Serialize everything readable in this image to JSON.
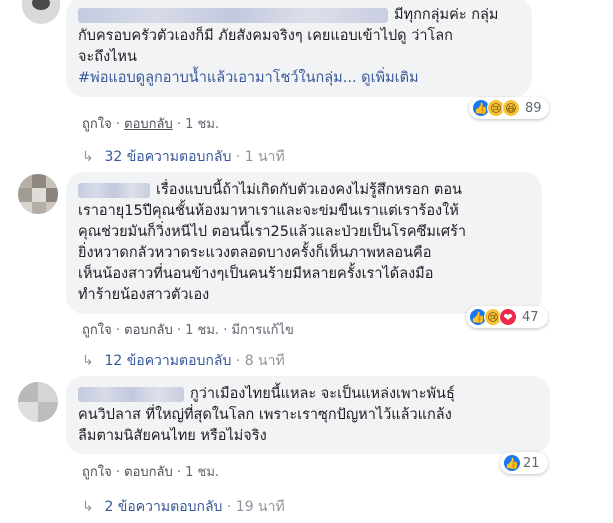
{
  "comments": [
    {
      "lines": [
        "มีทุกกลุ่มค่ะ กลุ่ม",
        "กับครอบครัวตัวเองก็มี ภัยสังคมจริงๆ เคยแอบเข้าไปดู ว่าโลก",
        "จะถึงไหน"
      ],
      "hashtag": "#พ่อแอบดูลูกอาบน้ำแล้วเอามาโชว์ในกลุ่ม...",
      "see_more": "ดูเพิ่มเติม",
      "reaction_count": "89",
      "reactions": [
        "like-icon",
        "sad-icon",
        "haha-icon"
      ],
      "actions": {
        "like": "ถูกใจ",
        "reply": "ตอบกลับ",
        "time": "1 ชม."
      },
      "replies": {
        "label": "32 ข้อความตอบกลับ",
        "time": "1 นาที"
      }
    },
    {
      "lines": [
        "เรื่องแบบนี้ถ้าไม่เกิดกับตัวเองคงไม่รู้สึกหรอก ตอน",
        "เราอายุ15ปีคุณชั้นห้องมาหาเราและจะข่มขืนเราแต่เราร้องให้",
        "คุณช่วยมันก็วิ่งหนีไป ตอนนี้เรา25แล้วและป่วยเป็นโรคซึมเศร้า",
        "ยิ่งหวาดกลัวหวาดระแวงตลอดบางครั้งก็เห็นภาพหลอนคือ",
        "เห็นน้องสาวที่นอนข้างๆเป็นคนร้ายมีหลายครั้งเราได้ลงมือ",
        "ทำร้ายน้องสาวตัวเอง"
      ],
      "reaction_count": "47",
      "reactions": [
        "like-icon",
        "sad-icon",
        "love-icon"
      ],
      "actions": {
        "like": "ถูกใจ",
        "reply": "ตอบกลับ",
        "time": "1 ชม.",
        "edited": "มีการแก้ไข"
      },
      "replies": {
        "label": "12 ข้อความตอบกลับ",
        "time": "8 นาที"
      }
    },
    {
      "lines": [
        "กูว่าเมืองไทยนี้แหละ จะเป็นแหล่งเพาะพันธุ์",
        "คนวิปลาส ที่ใหญ่ที่สุดในโลก เพราะเราซุกปัญหาไว้แล้วแกล้ง",
        "ลืมตามนิสัยคนไทย หรือไม่จริง"
      ],
      "reaction_count": "21",
      "reactions": [
        "like-icon"
      ],
      "actions": {
        "like": "ถูกใจ",
        "reply": "ตอบกลับ",
        "time": "1 ชม."
      },
      "replies": {
        "label": "2 ข้อความตอบกลับ",
        "time": "19 นาที"
      }
    }
  ]
}
